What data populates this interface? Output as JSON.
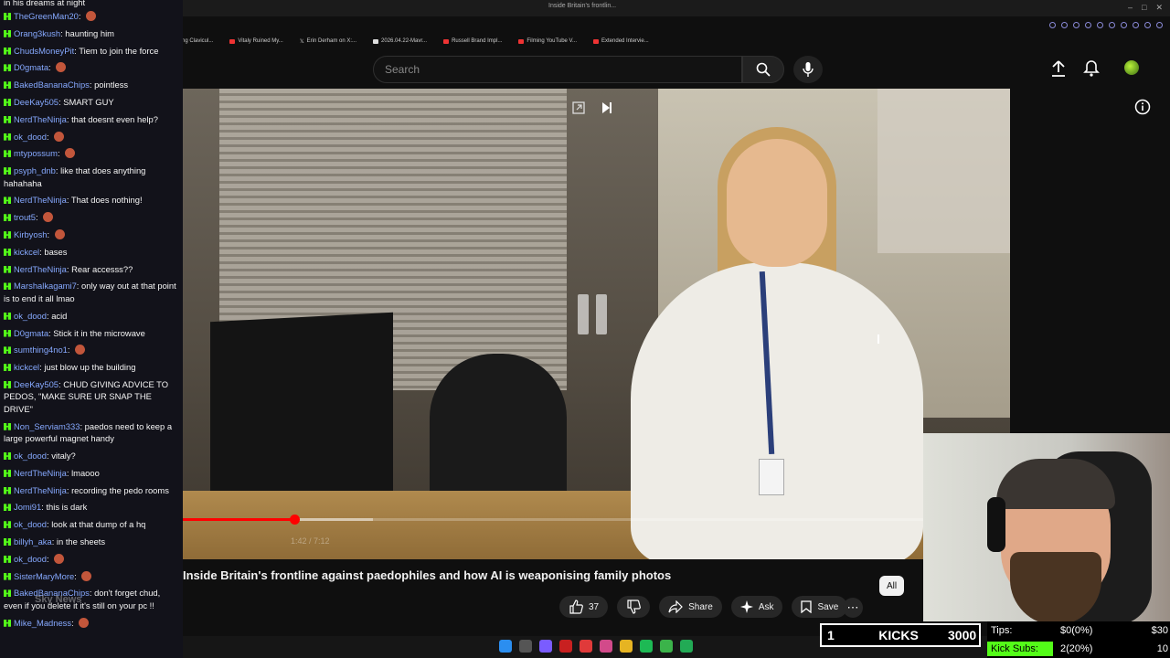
{
  "chat": {
    "top_fragment": "in his dreams at night",
    "messages": [
      {
        "user": "TheGreenMan20",
        "text": ""
      },
      {
        "user": "Orang3kush",
        "text": "haunting him"
      },
      {
        "user": "ChudsMoneyPit",
        "text": "Tiem to join the force"
      },
      {
        "user": "D0gmata",
        "text": ""
      },
      {
        "user": "BakedBananaChips",
        "text": "pointless"
      },
      {
        "user": "DeeKay505",
        "text": "SMART GUY"
      },
      {
        "user": "NerdTheNinja",
        "text": "that doesnt even help?"
      },
      {
        "user": "ok_dood",
        "text": ""
      },
      {
        "user": "mtypossum",
        "text": ""
      },
      {
        "user": "psyph_dnb",
        "text": "like that does anything hahahaha"
      },
      {
        "user": "NerdTheNinja",
        "text": "That does nothing!"
      },
      {
        "user": "trout5",
        "text": ""
      },
      {
        "user": "Kirbyosh",
        "text": ""
      },
      {
        "user": "kickcel",
        "text": "bases"
      },
      {
        "user": "NerdTheNinja",
        "text": "Rear accesss??"
      },
      {
        "user": "Marshalkagami7",
        "text": "only way out at that point is to end it all lmao"
      },
      {
        "user": "ok_dood",
        "text": "acid"
      },
      {
        "user": "D0gmata",
        "text": "Stick it in the microwave"
      },
      {
        "user": "sumthing4no1",
        "text": ""
      },
      {
        "user": "kickcel",
        "text": "just blow up the building"
      },
      {
        "user": "DeeKay505",
        "text": "CHUD GIVING ADVICE TO PEDOS, \"MAKE SURE UR SNAP THE DRIVE\""
      },
      {
        "user": "Non_Serviam333",
        "text": "paedos need to keep a large powerful magnet handy"
      },
      {
        "user": "ok_dood",
        "text": "vitaly?"
      },
      {
        "user": "NerdTheNinja",
        "text": "lmaooo"
      },
      {
        "user": "NerdTheNinja",
        "text": "recording the pedo rooms"
      },
      {
        "user": "Jomi91",
        "text": "this is dark"
      },
      {
        "user": "ok_dood",
        "text": "look at that dump of a hq"
      },
      {
        "user": "billyh_aka",
        "text": "in the sheets"
      },
      {
        "user": "ok_dood",
        "text": ""
      },
      {
        "user": "SisterMaryMore",
        "text": ""
      },
      {
        "user": "BakedBananaChips",
        "text": "don't forget chud, even if you delete it it's still on your pc !!"
      },
      {
        "user": "Mike_Madness",
        "text": ""
      }
    ]
  },
  "browser": {
    "bookmarks": [
      "Exposing Clavicul...",
      "Vitaly Ruined My...",
      "Erin Derham on X:...",
      "2026.04.22-Mavr...",
      "Russell Brand Impl...",
      "Filming YouTube V...",
      "Extended Intervie..."
    ],
    "tab_label": "Inside Britain's frontlin..."
  },
  "youtube": {
    "search_placeholder": "Search",
    "video_title": "Inside Britain's frontline against paedophiles and how AI is weaponising family photos",
    "channel_name": "Sky News",
    "time_display": "1:42 / 7:12",
    "progress_played_fraction": 0.135,
    "progress_buffer_fraction": 0.23,
    "like_count": "37",
    "share_label": "Share",
    "ask_label": "Ask",
    "save_label": "Save",
    "chip_all": "All"
  },
  "overlay": {
    "kicks_count": "1",
    "kicks_label": "KICKS",
    "kicks_goal": "3000",
    "tips_label": "Tips:",
    "tips_value": "$0(0%)",
    "tips_goal": "$30",
    "subs_label": "Kick Subs:",
    "subs_value": "2(20%)",
    "subs_goal": "10"
  },
  "colors": {
    "kick_green": "#53fc18",
    "yt_red": "#ff0000",
    "username_blue": "#86a9ff"
  }
}
